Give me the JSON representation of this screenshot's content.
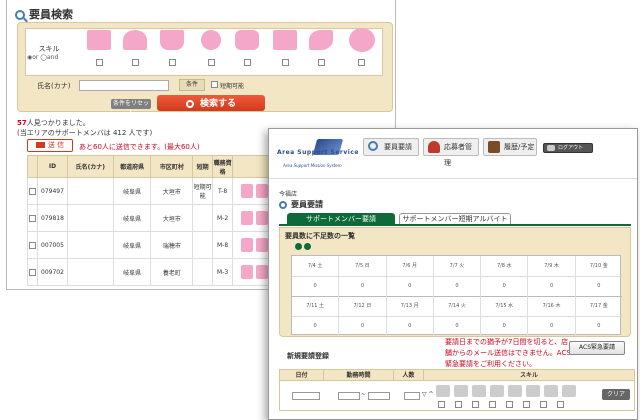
{
  "back_window": {
    "title": "要員検索",
    "skill_label": "スキル",
    "skill_radio_text": "◉or ◯and",
    "skill_icons": [
      "face-skill-icon",
      "dress-skill-icon",
      "shirt-skill-icon",
      "mic-skill-icon",
      "camera-skill-icon",
      "book-skill-icon",
      "teach-skill-icon",
      "costume-skill-icon"
    ],
    "name_label": "氏名(カナ)",
    "name_value": "",
    "condition_label": "条件",
    "short_term_label": "短期可能",
    "reset_label": "条件をリセット",
    "search_label": "検索する",
    "result_count": "57",
    "result_suffix": "人見つかりました。",
    "area_note": "(当エリアのサポートメンバは 412 人です)",
    "send_label": "送 信",
    "send_note": "あと60人に送信できます。(最大60人)",
    "table": {
      "headers": [
        "",
        "ID",
        "氏名(カナ)",
        "都道府県",
        "市区町村",
        "短期",
        "職務資格",
        ""
      ],
      "rows": [
        {
          "id": "079497",
          "pref": "岐阜県",
          "city": "大垣市",
          "short": "短期可能",
          "rank": "T-8"
        },
        {
          "id": "079818",
          "pref": "岐阜県",
          "city": "大垣市",
          "short": "",
          "rank": "M-2"
        },
        {
          "id": "007005",
          "pref": "岐阜県",
          "city": "瑞穂市",
          "short": "",
          "rank": "M-8"
        },
        {
          "id": "009702",
          "pref": "岐阜県",
          "city": "養老町",
          "short": "",
          "rank": "M-3"
        }
      ]
    }
  },
  "front_window": {
    "logo_text": "Area Support Service",
    "logo_sub": "Area Support Mission System",
    "nav": [
      "要員要請",
      "応募者管理",
      "履歴/予定",
      "ログアウト"
    ],
    "store_name": "今福店",
    "page_title": "要員要請",
    "tabs": [
      "サポートメンバー要請",
      "サポートメンバー短期アルバイト"
    ],
    "shortage_title": "要員数に不足数の一覧",
    "grid": {
      "dates1": [
        "7/4 土",
        "7/5 日",
        "7/6 月",
        "7/7 火",
        "7/8 水",
        "7/9 木",
        "7/10 金"
      ],
      "values1": [
        "0",
        "0",
        "0",
        "0",
        "0",
        "0",
        "0"
      ],
      "dates2": [
        "7/11 土",
        "7/12 日",
        "7/13 月",
        "7/14 火",
        "7/15 水",
        "7/16 木",
        "7/17 金"
      ],
      "values2": [
        "0",
        "0",
        "0",
        "0",
        "0",
        "0",
        "0"
      ]
    },
    "new_request_label": "新規要請登録",
    "red_note": "要請日までの猶予が7日間を切ると、店舗からのメール送信はできません。ACS緊急要請をご利用ください。",
    "acs_button": "ACS緊急要請",
    "req_headers": [
      "日付",
      "勤務時間",
      "人数",
      "スキル"
    ],
    "tilde": "~",
    "ctrl_a": "▽ ^",
    "clear_label": "クリア"
  }
}
